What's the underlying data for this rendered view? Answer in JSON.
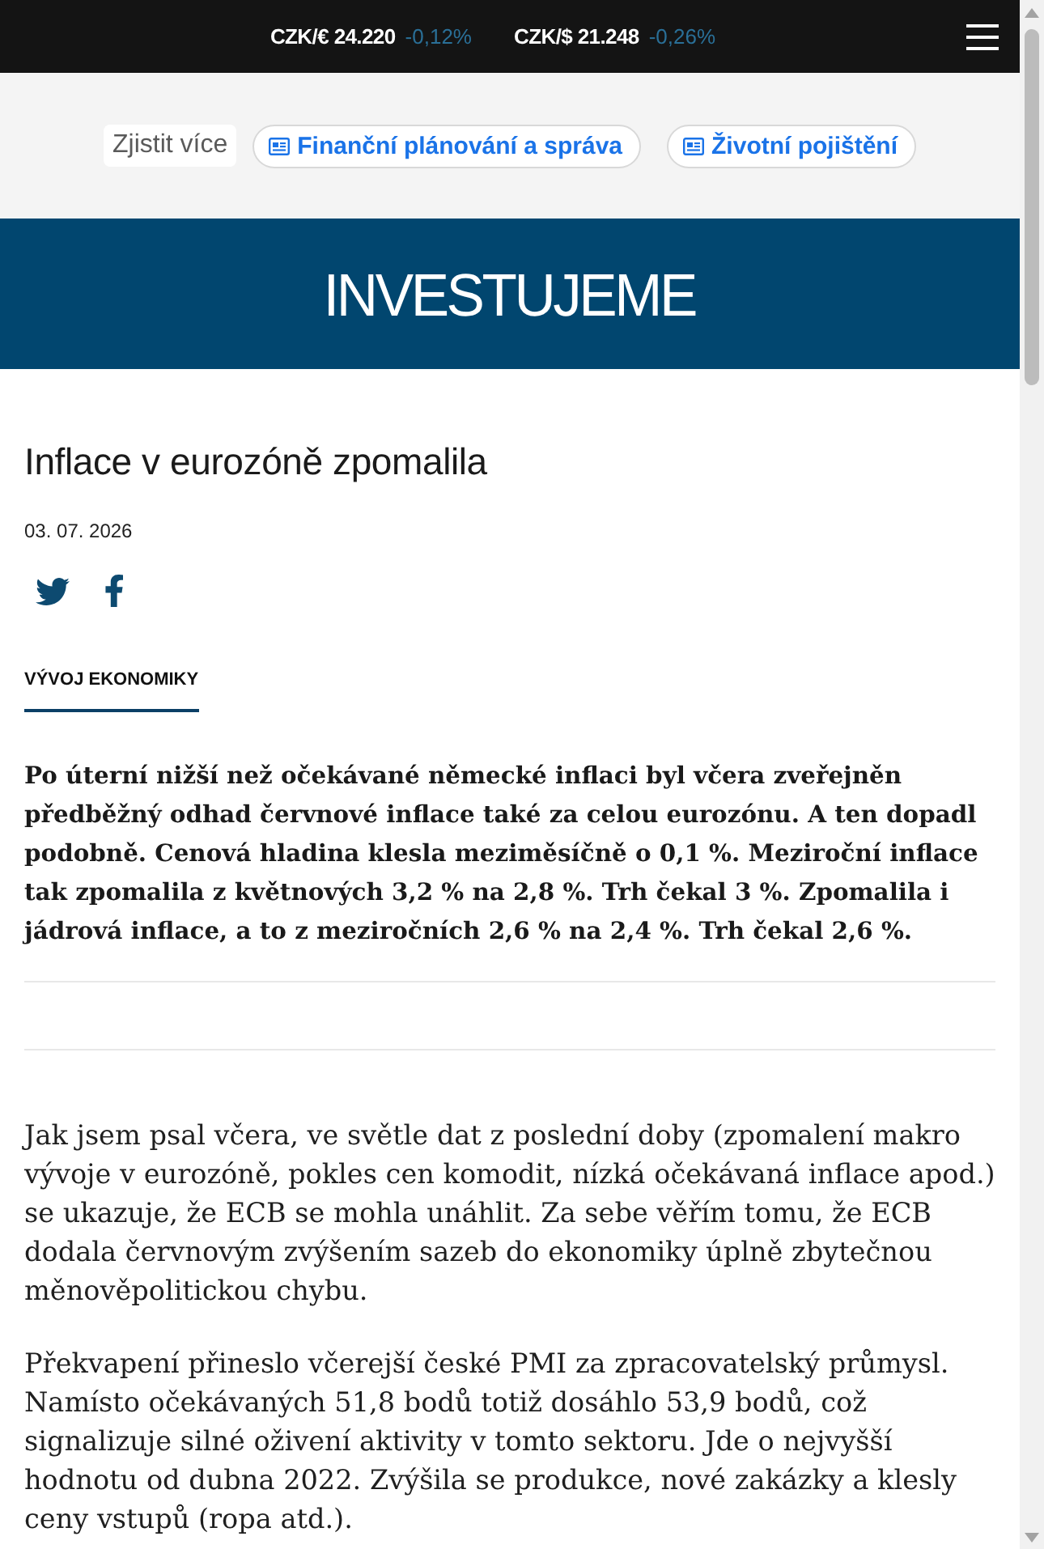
{
  "ticker": [
    {
      "label": "CZK/€ 24.220",
      "change": "-0,12%"
    },
    {
      "label": "CZK/$ 21.248",
      "change": "-0,26%"
    }
  ],
  "explore": {
    "label": "Zjistit více",
    "links": [
      "Finanční plánování a správa",
      "Životní pojištění"
    ]
  },
  "brand": {
    "title": "INVESTUJEME"
  },
  "article": {
    "title": "Inflace v eurozóně zpomalila",
    "date": "03. 07. 2026",
    "category": "VÝVOJ EKONOMIKY",
    "lead": "Po úterní nižší než očekávané německé inflaci byl včera zveřejněn předběžný odhad červnové inflace také za celou eurozónu. A ten dopadl podobně. Cenová hladina klesla meziměsíčně o 0,1 %. Meziroční inflace tak zpomalila z květnových 3,2 % na 2,8 %. Trh čekal 3 %. Zpomalila i jádrová inflace, a to z meziročních 2,6 % na 2,4 %. Trh čekal 2,6 %.",
    "paragraphs": [
      "Jak jsem psal včera, ve světle dat z poslední doby (zpomalení makro vývoje v eurozóně, pokles cen komodit, nízká očekávaná inflace apod.) se ukazuje, že ECB se mohla unáhlit. Za sebe věřím tomu, že ECB dodala červnovým zvýšením sazeb do ekonomiky úplně zbytečnou měnověpolitickou chybu.",
      "Překvapení přineslo včerejší české PMI za zpracovatelský průmysl. Namísto očekávaných 51,8 bodů totiž dosáhlo 53,9 bodů, což signalizuje silné oživení aktivity v tomto sektoru. Jde o nejvyšší hodnotu od dubna 2022. Zvýšila se produkce, nové zakázky a klesly ceny vstupů (ropa atd.)."
    ]
  }
}
